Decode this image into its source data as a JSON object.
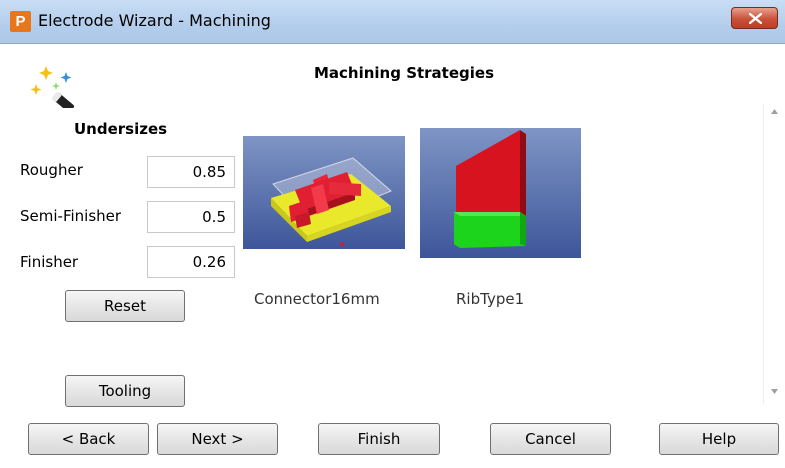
{
  "window": {
    "title": "Electrode Wizard - Machining",
    "app_icon_letter": "P",
    "accent": "#e8761a"
  },
  "heading": "Machining Strategies",
  "undersizes": {
    "label": "Undersizes",
    "fields": [
      {
        "label": "Rougher",
        "value": "0.85"
      },
      {
        "label": "Semi-Finisher",
        "value": "0.5"
      },
      {
        "label": "Finisher",
        "value": "0.26"
      }
    ],
    "reset_label": "Reset"
  },
  "tooling_label": "Tooling",
  "strategies": [
    {
      "name": "Connector16mm",
      "icon": "connector-thumbnail"
    },
    {
      "name": "RibType1",
      "icon": "rib-thumbnail"
    }
  ],
  "footer": {
    "back": "< Back",
    "next": "Next >",
    "finish": "Finish",
    "cancel": "Cancel",
    "help": "Help"
  }
}
